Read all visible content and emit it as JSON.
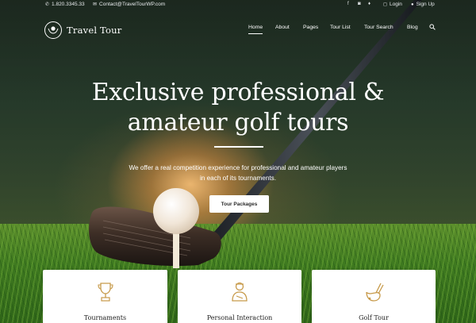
{
  "topbar": {
    "phone": "1.820.3345.33",
    "email": "Contact@TravelTourWP.com",
    "login": "Login",
    "signup": "Sign Up",
    "social_icons": [
      "facebook-icon",
      "flickr-icon",
      "twitter-icon",
      "instagram-icon"
    ]
  },
  "brand": {
    "name": "Travel Tour"
  },
  "nav": {
    "items": [
      "Home",
      "About",
      "Pages",
      "Tour List",
      "Tour Search",
      "Blog"
    ],
    "active": "Home"
  },
  "hero": {
    "headline_line1": "Exclusive professional &",
    "headline_line2": "amateur golf tours",
    "subtext_line1": "We offer a real competition experience for professional and amateur players",
    "subtext_line2": "in each of its tournaments.",
    "cta_label": "Tour Packages"
  },
  "cards": [
    {
      "title": "Tournaments",
      "icon": "trophy-icon"
    },
    {
      "title": "Personal Interaction",
      "icon": "golfer-icon"
    },
    {
      "title": "Golf Tour",
      "icon": "golf-bag-icon"
    }
  ],
  "colors": {
    "text_light": "#ffffff",
    "grass": "#3f7a20",
    "card_bg": "#ffffff",
    "icon_gold": "#c79a4a"
  }
}
